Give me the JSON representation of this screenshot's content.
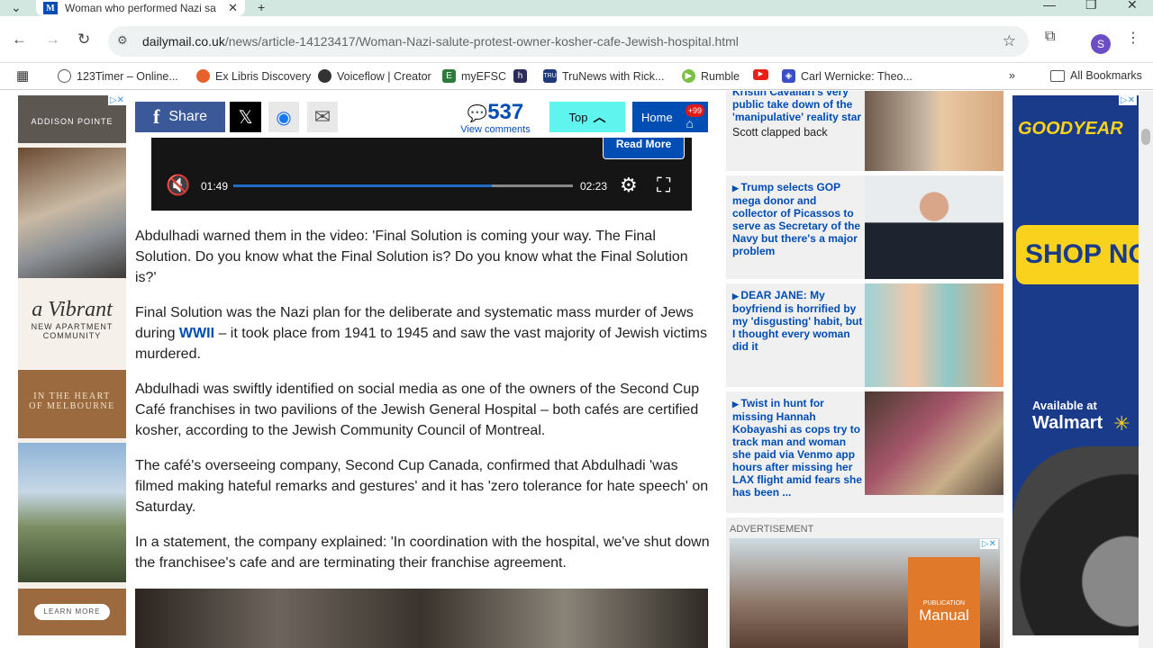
{
  "browser": {
    "tab_title": "Woman who performed Nazi sa",
    "tab_favicon": "M",
    "url_host": "dailymail.co.uk",
    "url_path": "/news/article-14123417/Woman-Nazi-salute-protest-owner-kosher-cafe-Jewish-hospital.html",
    "profile_initial": "S"
  },
  "bookmarks": [
    {
      "label": "123Timer – Online...",
      "icon": "clock-icon"
    },
    {
      "label": "Ex Libris Discovery",
      "icon": "exlibris-icon"
    },
    {
      "label": "Voiceflow | Creator",
      "icon": "voiceflow-icon"
    },
    {
      "label": "myEFSC",
      "icon": "efsc-icon"
    },
    {
      "label": "",
      "icon": "h-icon"
    },
    {
      "label": "TruNews with Rick...",
      "icon": "trunews-icon"
    },
    {
      "label": "Rumble",
      "icon": "rumble-icon"
    },
    {
      "label": "",
      "icon": "youtube-icon"
    },
    {
      "label": "Carl Wernicke: Theo...",
      "icon": "carl-icon"
    }
  ],
  "all_bookmarks": "All Bookmarks",
  "share": {
    "share_label": "Share",
    "comment_count": "537",
    "view_comments": "View comments",
    "top_label": "Top",
    "home_label": "Home",
    "home_badge": "+99"
  },
  "video": {
    "read_more": "Read More",
    "elapsed": "01:49",
    "duration": "02:23",
    "progress_fraction": 0.76
  },
  "article": {
    "p1": "Abdulhadi warned them in the video: 'Final Solution is coming your way. The Final Solution. Do you know what the Final Solution is? Do you know what the Final Solution is?'",
    "p2_before": "Final Solution was the Nazi plan for the deliberate and systematic mass murder of Jews during ",
    "p2_link": "WWII",
    "p2_after": " – it took place from 1941 to 1945 and saw the vast majority of Jewish victims murdered.",
    "p3": "Abdulhadi was swiftly identified on social media as one of the owners of the Second Cup Café franchises in two pavilions of the Jewish General Hospital – both cafés are certified kosher, according to the Jewish Community Council of Montreal.",
    "p4": "The café's overseeing company, Second Cup Canada, confirmed that Abdulhadi 'was filmed making hateful remarks and gestures' and it has 'zero tolerance for hate speech' on Saturday.",
    "p5": "In a statement, the company explained: 'In coordination with the hospital, we've shut down the franchisee's cafe and are terminating their franchise agreement."
  },
  "sidebar": [
    {
      "headline": "Kristin Cavallari's very public take down of the 'manipulative' reality star",
      "sub": "Scott clapped back"
    },
    {
      "headline": "Trump selects GOP mega donor and collector of Picassos to serve as Secretary of the Navy but there's a major problem",
      "sub": ""
    },
    {
      "headline": "DEAR JANE: My boyfriend is horrified by my 'disgusting' habit, but I thought every woman did it",
      "sub": ""
    },
    {
      "headline": "Twist in hunt for missing Hannah Kobayashi as cops try to track man and woman she paid via Venmo app hours after missing her LAX flight amid fears she has been ...",
      "sub": ""
    }
  ],
  "advert": {
    "label": "ADVERTISEMENT",
    "book_small": "PUBLICATION",
    "book_title": "Manual"
  },
  "left_ad": {
    "brand": "ADDISON POINTE",
    "script": "a Vibrant",
    "line1": "NEW APARTMENT",
    "line2": "COMMUNITY",
    "heart1": "IN THE HEART",
    "heart2": "OF MELBOURNE",
    "cta": "LEARN MORE"
  },
  "right_ad": {
    "brand": "GOODYEAR",
    "headline": "SHOP NOW",
    "avail": "Available at",
    "store": "Walmart"
  }
}
